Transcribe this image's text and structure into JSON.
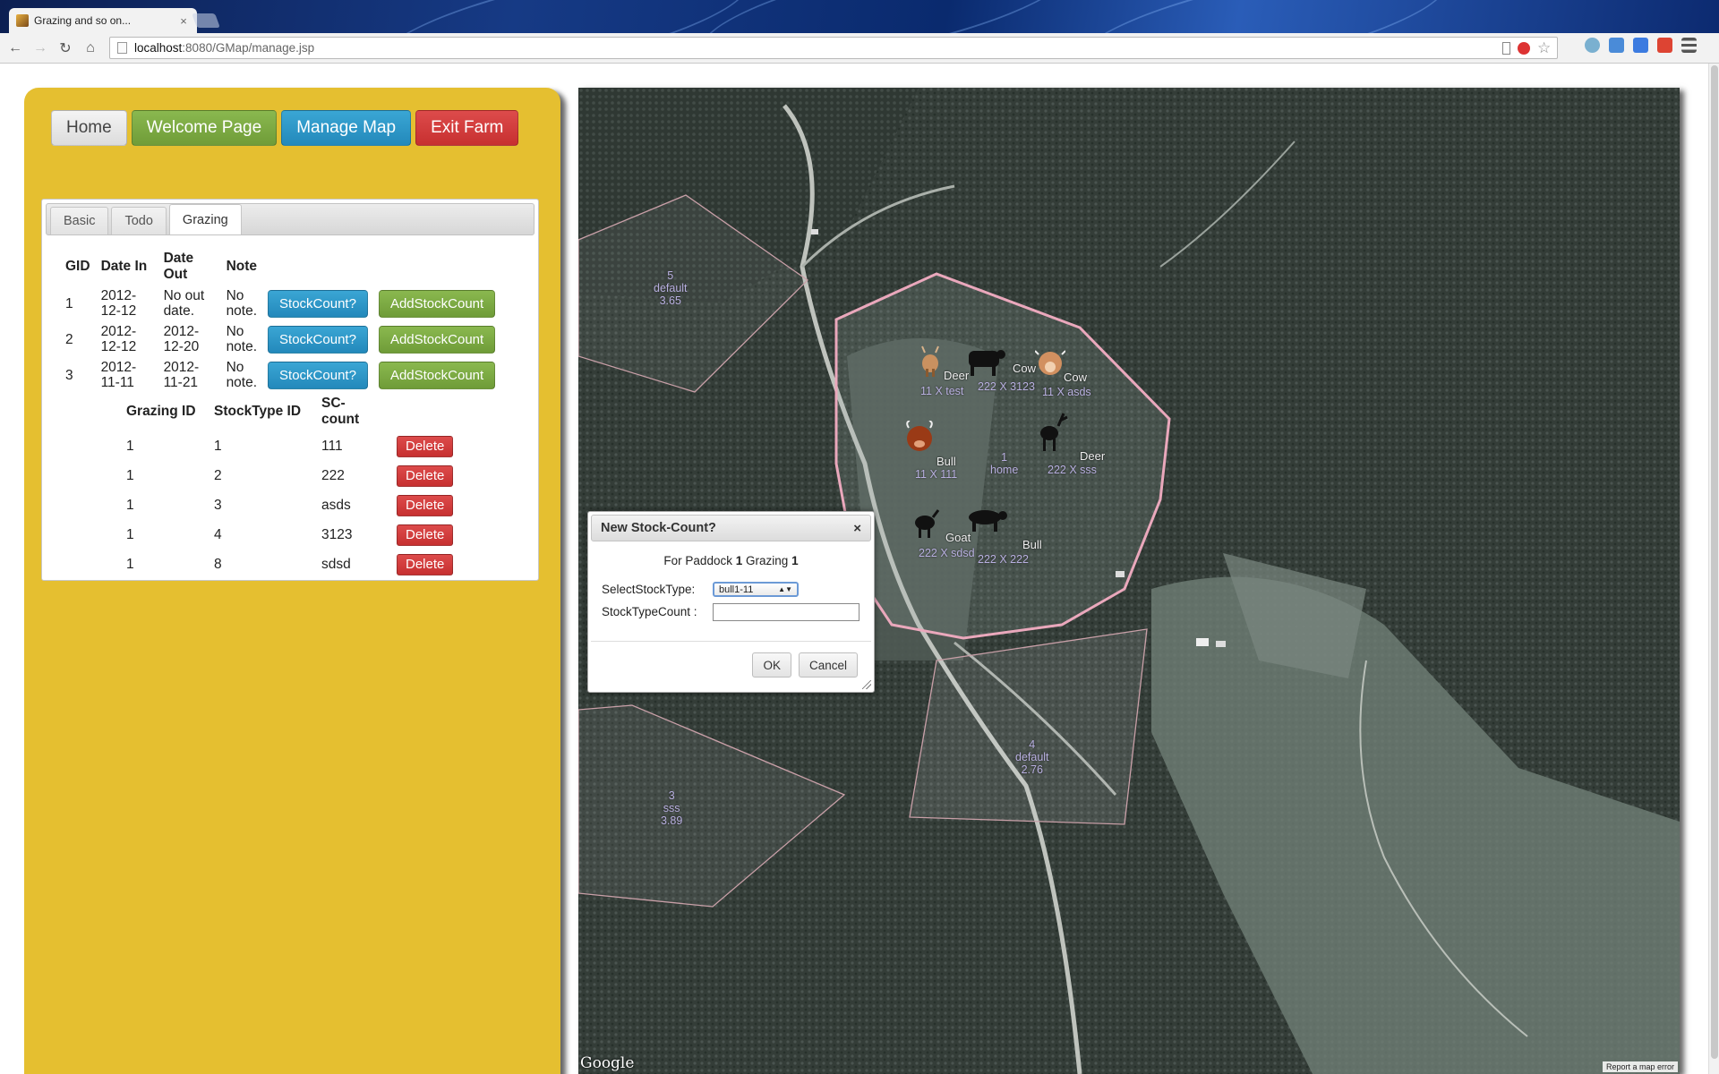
{
  "browser": {
    "tab_title": "Grazing and so on...",
    "tab_close": "×",
    "url_host": "localhost",
    "url_path": ":8080/GMap/manage.jsp"
  },
  "nav": {
    "home": "Home",
    "welcome": "Welcome Page",
    "manage": "Manage Map",
    "exit": "Exit Farm"
  },
  "tabs": [
    {
      "label": "Basic",
      "active": false
    },
    {
      "label": "Todo",
      "active": false
    },
    {
      "label": "Grazing",
      "active": true
    }
  ],
  "grazing_table": {
    "headers": [
      "GID",
      "Date In",
      "Date Out",
      "Note"
    ],
    "stock_count_label": "StockCount?",
    "add_stock_count_label": "AddStockCount",
    "rows": [
      {
        "gid": "1",
        "date_in": "2012-12-12",
        "date_out": "No out date.",
        "note": "No note."
      },
      {
        "gid": "2",
        "date_in": "2012-12-12",
        "date_out": "2012-12-20",
        "note": "No note."
      },
      {
        "gid": "3",
        "date_in": "2012-11-11",
        "date_out": "2012-11-21",
        "note": "No note."
      }
    ]
  },
  "stock_table": {
    "headers": [
      "Grazing ID",
      "StockType ID",
      "SC-count"
    ],
    "delete_label": "Delete",
    "rows": [
      {
        "grazing_id": "1",
        "stocktype_id": "1",
        "count": "111"
      },
      {
        "grazing_id": "1",
        "stocktype_id": "2",
        "count": "222"
      },
      {
        "grazing_id": "1",
        "stocktype_id": "3",
        "count": "asds"
      },
      {
        "grazing_id": "1",
        "stocktype_id": "4",
        "count": "3123"
      },
      {
        "grazing_id": "1",
        "stocktype_id": "8",
        "count": "sdsd"
      }
    ]
  },
  "map": {
    "paddocks": [
      {
        "id": "5",
        "name": "default",
        "area": "3.65"
      },
      {
        "id": "1",
        "name": "home",
        "area": ""
      },
      {
        "id": "4",
        "name": "default",
        "area": "2.76"
      },
      {
        "id": "3",
        "name": "sss",
        "area": "3.89"
      }
    ],
    "markers": [
      {
        "animal": "Deer",
        "label": "11 X test"
      },
      {
        "animal": "Cow",
        "label": "222 X 3123"
      },
      {
        "animal": "Cow",
        "label": "11 X asds"
      },
      {
        "animal": "Bull",
        "label": "11 X 111"
      },
      {
        "animal": "Deer",
        "label": "222 X sss"
      },
      {
        "animal": "Goat",
        "label": "222 X sdsd"
      },
      {
        "animal": "Bull",
        "label": "222 X 222"
      }
    ],
    "google": "Google",
    "report_error": "Report a map error"
  },
  "dialog": {
    "title": "New Stock-Count?",
    "close": "×",
    "for_paddock_prefix": "For Paddock",
    "paddock_id": "1",
    "grazing_label": "Grazing",
    "grazing_id": "1",
    "select_label": "SelectStockType:",
    "select_value": "bull1-11",
    "count_label": "StockTypeCount :",
    "ok": "OK",
    "cancel": "Cancel"
  },
  "colors": {
    "panel": "#e5bf30",
    "blue_button": "#2a93c4",
    "green_button": "#78a840",
    "red_button": "#d03c3c"
  }
}
